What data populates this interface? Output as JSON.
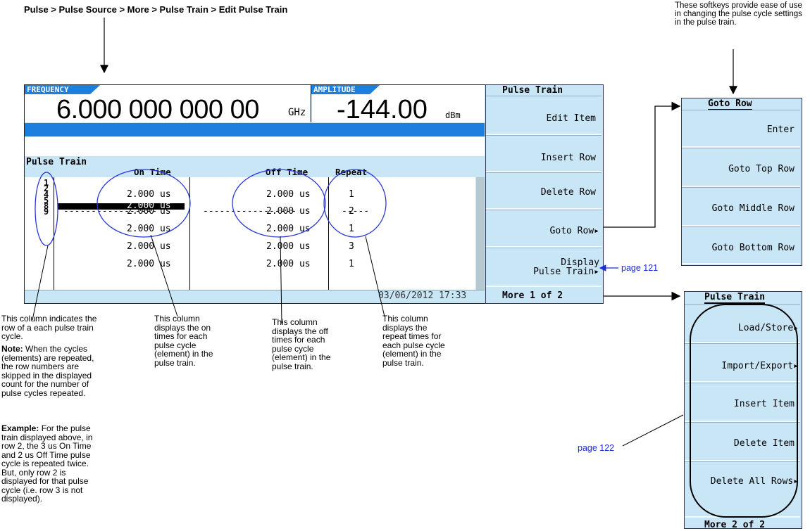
{
  "breadcrumb": "Pulse > Pulse Source > More > Pulse Train > Edit Pulse Train",
  "top_note": "These softkeys provide ease of use in changing the pulse cycle settings in the pulse train.",
  "screen": {
    "frequency_label": "FREQUENCY",
    "frequency_value": "6.000 000 000 00",
    "frequency_unit": "GHz",
    "amplitude_label": "AMPLITUDE",
    "amplitude_value": "-144.00",
    "amplitude_unit": "dBm",
    "table_title": "Pulse Train",
    "columns": {
      "on": "On Time",
      "off": "Off Time",
      "repeat": "Repeat"
    },
    "rows": [
      {
        "num": "1",
        "on": "2.000 us",
        "off": "2.000 us",
        "repeat": "1"
      },
      {
        "num": "2",
        "on": "2.000 us",
        "off": "2.000 us",
        "repeat": "2"
      },
      {
        "num": "4",
        "on": "2.000 us",
        "off": "2.000 us",
        "repeat": "1"
      },
      {
        "num": "5",
        "on": "2.000 us",
        "off": "2.000 us",
        "repeat": "3"
      },
      {
        "num": "8",
        "on": "2.000 us",
        "off": "2.000 us",
        "repeat": "1"
      },
      {
        "num": "9",
        "on": "-----------------",
        "off": "-----------------",
        "repeat": "-----"
      }
    ],
    "datetime": "03/06/2012 17:33"
  },
  "softkeys_main": {
    "title": "Pulse Train",
    "items": [
      "Edit Item",
      "Insert Row",
      "Delete Row",
      "Goto Row▸",
      "Display\nPulse Train▸"
    ],
    "more": "More 1 of 2"
  },
  "softkeys_goto": {
    "title": "Goto Row",
    "items": [
      "Enter",
      "Goto Top Row",
      "Goto Middle Row",
      "Goto Bottom Row"
    ]
  },
  "softkeys_more": {
    "title": "Pulse Train",
    "items": [
      "Load/Store▸",
      "Import/Export▸",
      "Insert Item",
      "Delete Item",
      "Delete All Rows▸"
    ],
    "more": "More 2 of 2"
  },
  "links": {
    "page121": "page 121",
    "page122": "page 122"
  },
  "captions": {
    "row_col": "This column indicates the row of a each pulse train cycle.",
    "note_label": "Note:",
    "note_text": " When the cycles (elements) are repeated, the row numbers are skipped in the displayed count for the number of pulse cycles repeated.",
    "example_label": "Example:",
    "example_text": " For the pulse train displayed above, in row 2, the 3 us On Time and 2 us Off Time pulse cycle is repeated twice. But, only row 2 is displayed for that pulse cycle (i.e. row 3 is not displayed).",
    "on_col": "This column displays the on times for each pulse cycle (element) in the pulse train.",
    "off_col": "This column displays the off times for each pulse cycle (element) in the pulse train.",
    "repeat_col": "This column displays the repeat times for each pulse cycle (element) in the pulse train."
  }
}
